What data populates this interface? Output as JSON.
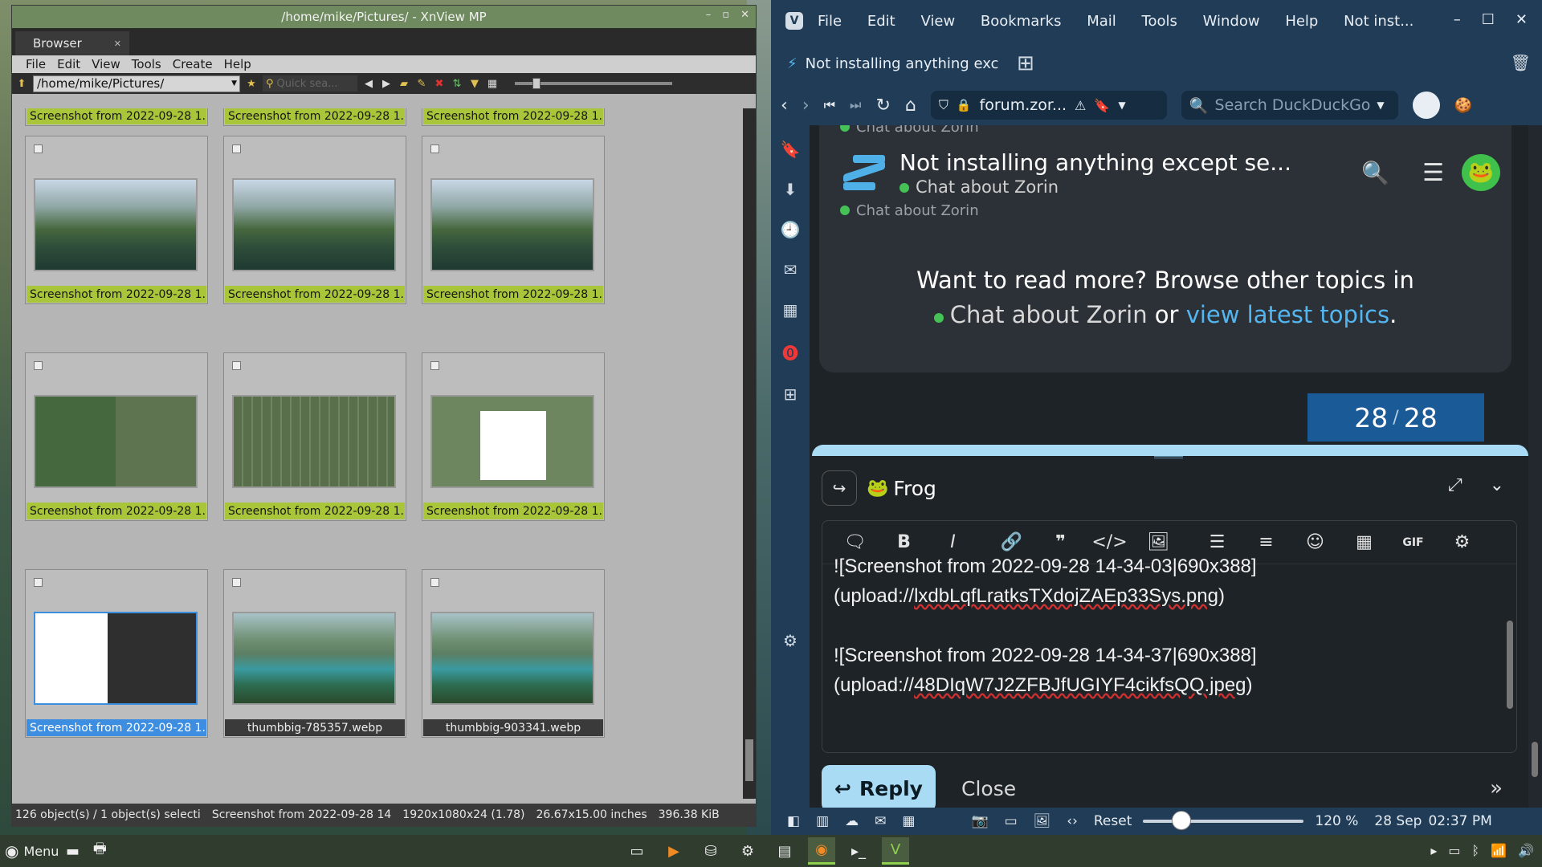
{
  "xnview": {
    "title": "/home/mike/Pictures/ - XnView MP",
    "tab": "Browser",
    "menu": [
      "File",
      "Edit",
      "View",
      "Tools",
      "Create",
      "Help"
    ],
    "path": "/home/mike/Pictures/",
    "quick_search_placeholder": "Quick sea...",
    "thumbnails": [
      {
        "label": "Screenshot from 2022-09-28 1...",
        "thumb": "t-lake"
      },
      {
        "label": "Screenshot from 2022-09-28 1...",
        "thumb": "t-lake"
      },
      {
        "label": "Screenshot from 2022-09-28 1...",
        "thumb": "t-lake"
      },
      {
        "label": "Screenshot from 2022-09-28 1...",
        "thumb": "t-lake"
      },
      {
        "label": "Screenshot from 2022-09-28 1...",
        "thumb": "t-lake"
      },
      {
        "label": "Screenshot from 2022-09-28 1...",
        "thumb": "t-lake"
      },
      {
        "label": "Screenshot from 2022-09-28 1...",
        "thumb": "t-mix"
      },
      {
        "label": "Screenshot from 2022-09-28 1...",
        "thumb": "t-green"
      },
      {
        "label": "Screenshot from 2022-09-28 1...",
        "thumb": "t-white"
      },
      {
        "label": "Screenshot from 2022-09-28 1...",
        "thumb": "t-dark",
        "selected": true
      },
      {
        "label": "thumbbig-785357.webp",
        "thumb": "t-island",
        "plain": true
      },
      {
        "label": "thumbbig-903341.webp",
        "thumb": "t-island",
        "plain": true
      }
    ],
    "status": {
      "count": "126 object(s) / 1 object(s) selecti",
      "name": "Screenshot from 2022-09-28 14",
      "dims": "1920x1080x24 (1.78)",
      "inches": "26.67x15.00 inches",
      "size": "396.38 KiB"
    }
  },
  "vivaldi": {
    "menu": [
      "File",
      "Edit",
      "View",
      "Bookmarks",
      "Mail",
      "Tools",
      "Window",
      "Help",
      "Not inst..."
    ],
    "tab_title": "Not installing anything exc",
    "address": "forum.zor...",
    "search_placeholder": "Search DuckDuckGo",
    "topic": {
      "ghost_category": "Chat about Zorin",
      "title": "Not installing anything except se...",
      "category": "Chat about Zorin"
    },
    "more": {
      "line1": "Want to read more? Browse other topics in",
      "category": "Chat about Zorin",
      "or": "or",
      "link": "view latest topics",
      "period": "."
    },
    "pager": {
      "current": "28",
      "sep": "/",
      "total": "28"
    },
    "composer": {
      "username": "Frog",
      "editor_lines": [
        {
          "pre": "![Screenshot from 2022-09-28 14-34-03|690x388]",
          "underline": ""
        },
        {
          "pre": "(upload://",
          "underline": "lxdbLqfLratksTXdojZAEp33Sys.png",
          "post": ")"
        },
        {
          "pre": "",
          "underline": ""
        },
        {
          "pre": "![Screenshot from 2022-09-28 14-34-37|690x388]",
          "underline": ""
        },
        {
          "pre": "(upload://",
          "underline": "48DIqW7J2ZFBJfUGIYF4cikfsQQ.jpeg",
          "post": ")"
        }
      ],
      "gif_label": "GIF",
      "reply_label": "Reply",
      "close_label": "Close"
    },
    "statusbar": {
      "reset": "Reset",
      "zoom": "120 %",
      "date": "28 Sep",
      "time": "02:37 PM"
    }
  },
  "taskbar": {
    "menu_label": "Menu"
  }
}
